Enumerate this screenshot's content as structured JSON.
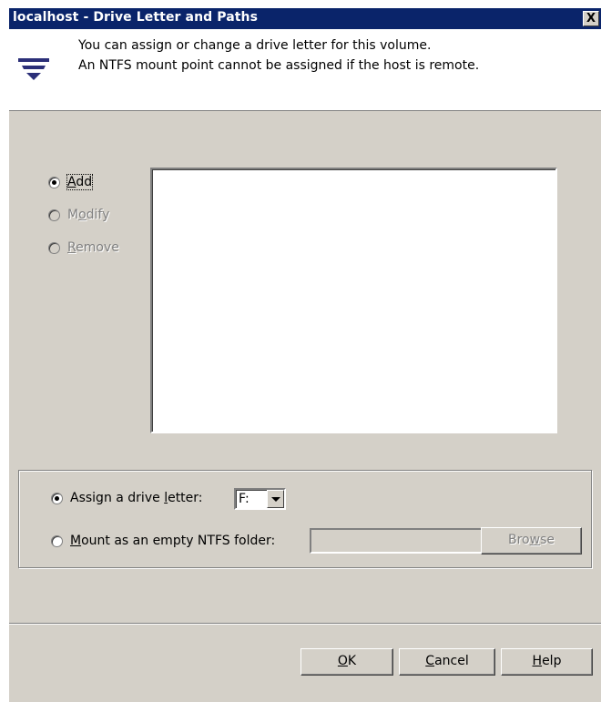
{
  "window": {
    "title": "localhost - Drive Letter and Paths",
    "close_label": "X"
  },
  "header": {
    "line1": "You can assign or change a drive letter for this volume.",
    "line2": "An NTFS mount point cannot be assigned if the host is remote.",
    "logo_icon": "veritas-logo-icon"
  },
  "actions": {
    "add": {
      "pre": "",
      "key": "A",
      "post": "dd",
      "checked": true,
      "enabled": true
    },
    "modify": {
      "pre": "M",
      "key": "o",
      "post": "dify",
      "checked": false,
      "enabled": false
    },
    "remove": {
      "pre": "",
      "key": "R",
      "post": "emove",
      "checked": false,
      "enabled": false
    }
  },
  "assign": {
    "letter_option": {
      "pre": "Assign a drive ",
      "key": "l",
      "post": "etter:",
      "checked": true
    },
    "drive_letter_value": "F:",
    "mount_option": {
      "pre": "",
      "key": "M",
      "post": "ount as an empty NTFS folder:",
      "checked": false
    },
    "folder_path_value": "",
    "browse": {
      "pre": "Bro",
      "key": "w",
      "post": "se",
      "enabled": false
    }
  },
  "buttons": {
    "ok": {
      "pre": "",
      "key": "O",
      "post": "K"
    },
    "cancel": {
      "pre": "",
      "key": "C",
      "post": "ancel"
    },
    "help": {
      "pre": "",
      "key": "H",
      "post": "elp"
    }
  },
  "colors": {
    "titlebar": "#0a246a",
    "face": "#d4d0c8",
    "logo": "#2b2f78"
  }
}
